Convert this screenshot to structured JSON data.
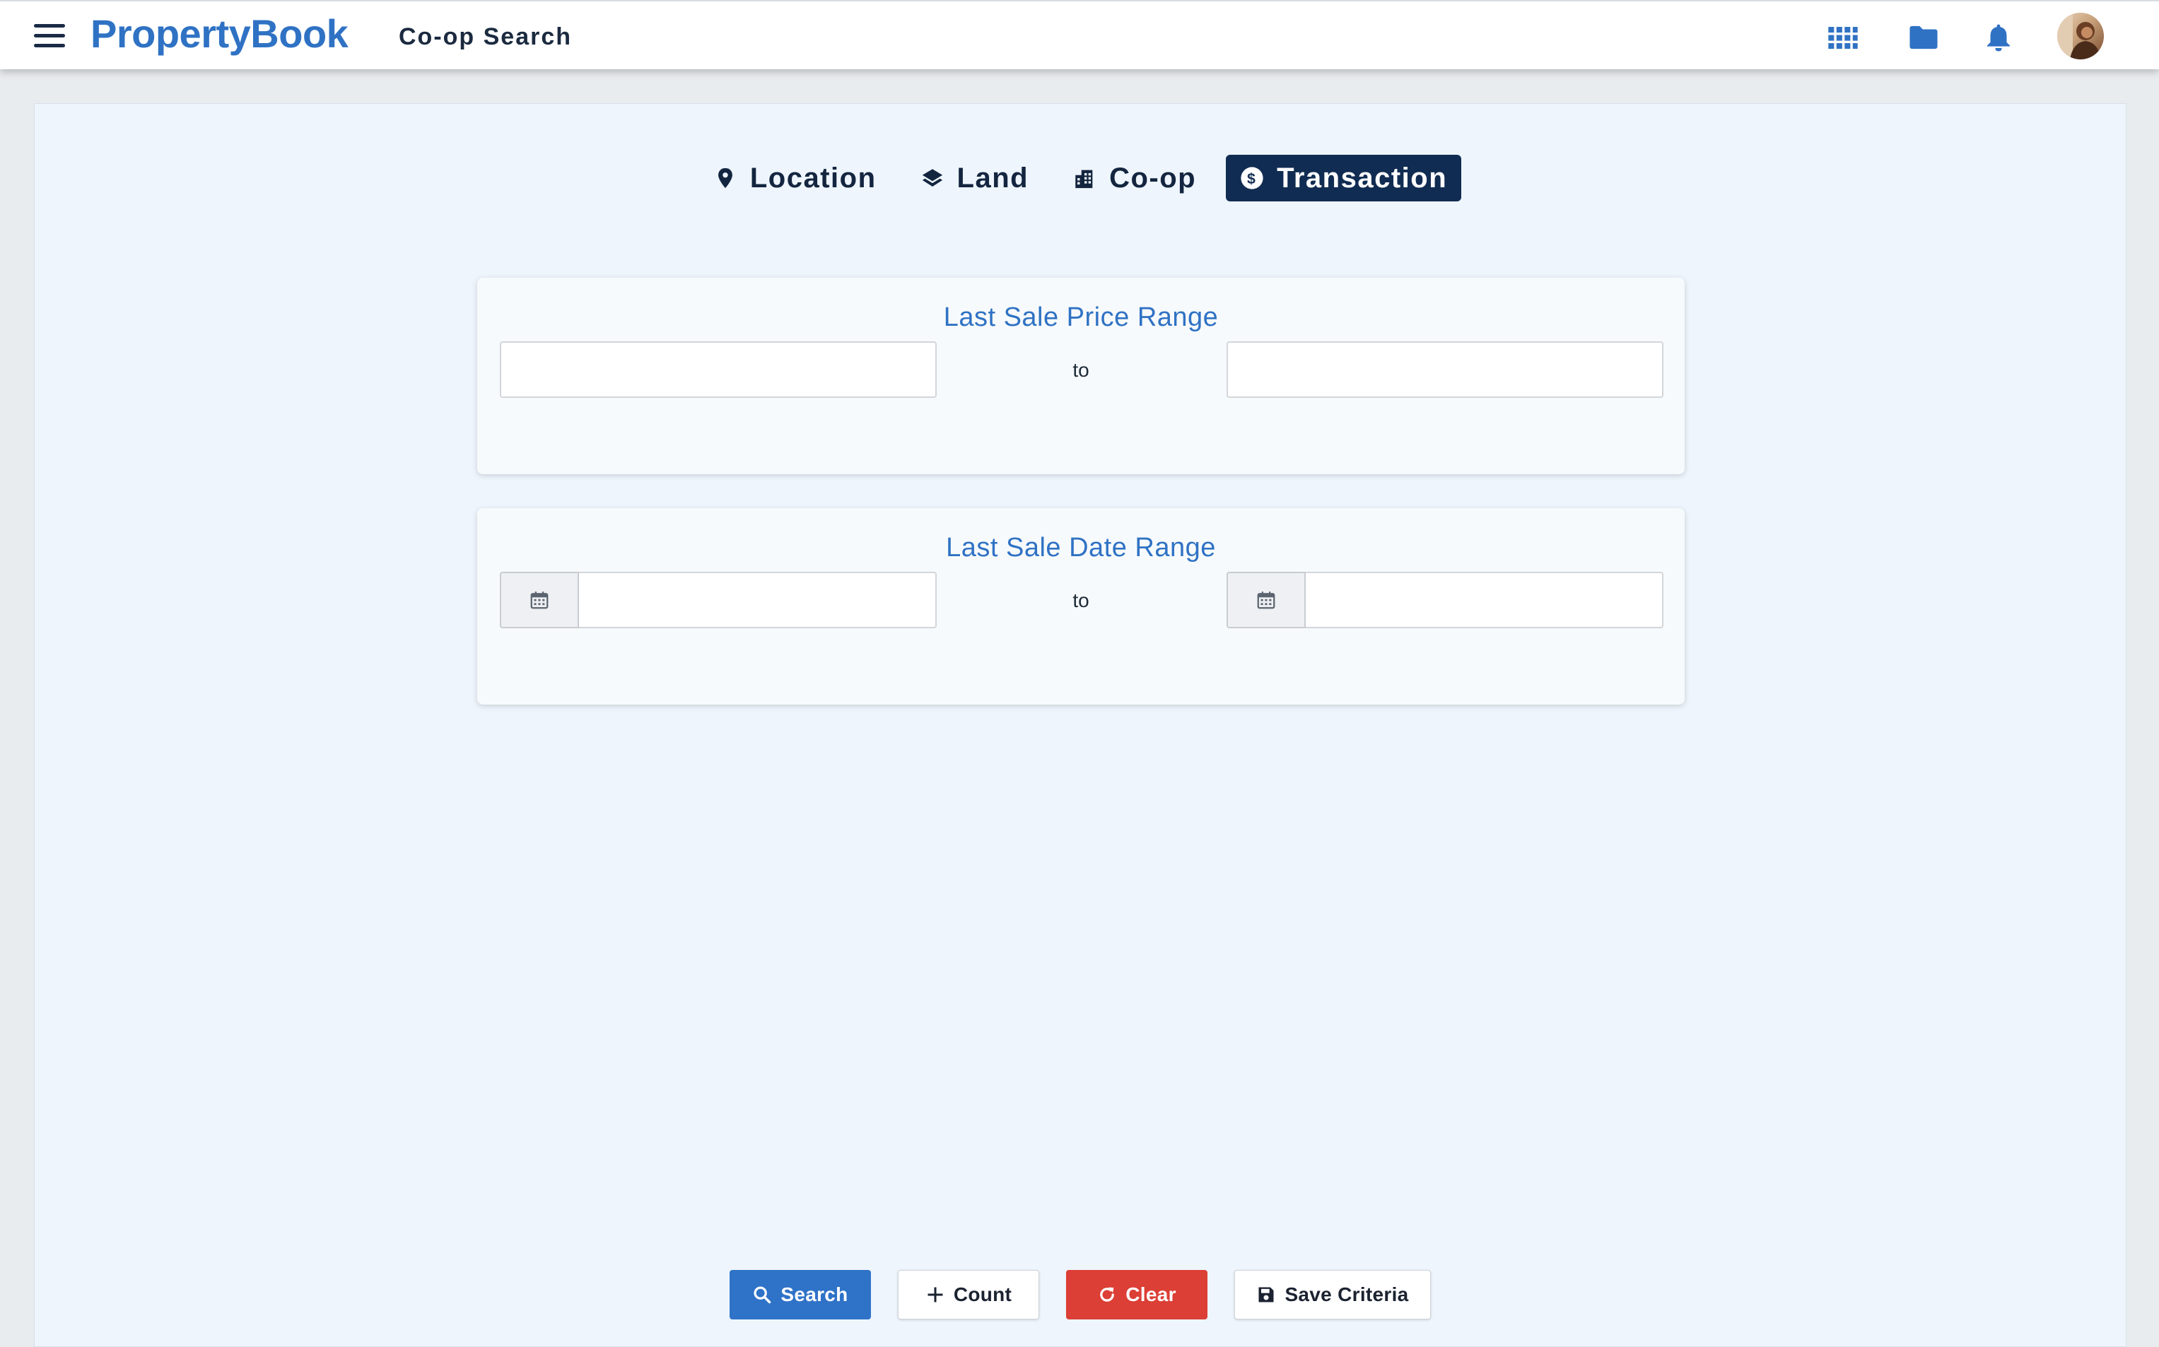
{
  "app": {
    "logo": "PropertyBook",
    "page_title": "Co-op Search"
  },
  "header_icons": [
    "apps-grid-icon",
    "folder-icon",
    "bell-icon",
    "user-avatar"
  ],
  "colors": {
    "brand": "#2f72c4",
    "active_tab": "#112c52",
    "search_button": "#2f73c8",
    "clear_button": "#dc3f35",
    "panel_background": "#eef5fc"
  },
  "tabs": [
    {
      "label": "Location",
      "icon": "map-pin-icon",
      "active": false
    },
    {
      "label": "Land",
      "icon": "layers-icon",
      "active": false
    },
    {
      "label": "Co-op",
      "icon": "building-icon",
      "active": false
    },
    {
      "label": "Transaction",
      "icon": "dollar-circle-icon",
      "active": true
    }
  ],
  "price_range": {
    "title": "Last Sale Price Range",
    "separator": "to",
    "min_value": "",
    "max_value": ""
  },
  "date_range": {
    "title": "Last Sale Date Range",
    "separator": "to",
    "start_value": "",
    "end_value": ""
  },
  "actions": {
    "search": "Search",
    "count": "Count",
    "clear": "Clear",
    "save": "Save Criteria"
  }
}
